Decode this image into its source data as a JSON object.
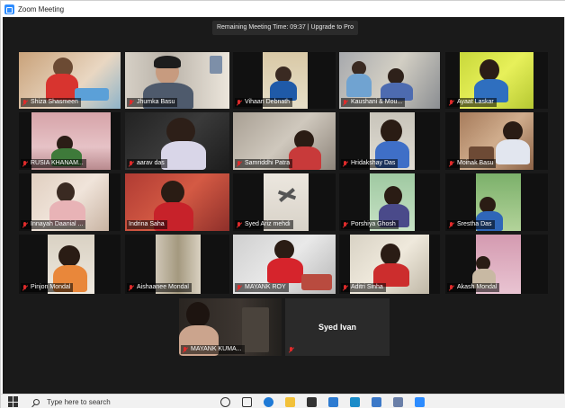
{
  "window": {
    "title": "Zoom Meeting"
  },
  "banner": {
    "text": "Remaining Meeting Time: 09:37 | Upgrade to Pro"
  },
  "participants": [
    {
      "name": "Shiza Shasmeen"
    },
    {
      "name": "Jhumka Basu"
    },
    {
      "name": "Vihaan Debnath"
    },
    {
      "name": "Kaushani & Mou..."
    },
    {
      "name": "Ayaat Laskar"
    },
    {
      "name": "RUSIA KHANAM..."
    },
    {
      "name": "aarav das"
    },
    {
      "name": "Samriddhi Patra"
    },
    {
      "name": "Hridakshay Das"
    },
    {
      "name": "Moinak Basu"
    },
    {
      "name": "Innayah Daanial ..."
    },
    {
      "name": "Indrina Saha"
    },
    {
      "name": "Syed Ariz mehdi"
    },
    {
      "name": "Porshiya Ghosh"
    },
    {
      "name": "Srestha Das"
    },
    {
      "name": "Pinjon Mondal"
    },
    {
      "name": "Aishaanee Mondal"
    },
    {
      "name": "MAYANK ROY"
    },
    {
      "name": "Aditri Sinha"
    },
    {
      "name": "Akash Mondal"
    },
    {
      "name": "MAYANK KUMA..."
    },
    {
      "name": "Syed Ivan"
    }
  ],
  "taskbar": {
    "search_placeholder": "Type here to search"
  },
  "colors": {
    "zoom_blue": "#2d8cff",
    "active_speaker": "#d7e34a",
    "muted": "#e02b2b"
  }
}
